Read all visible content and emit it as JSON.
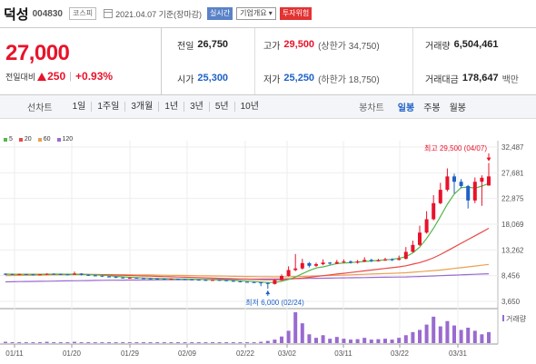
{
  "header": {
    "name": "덕성",
    "code": "004830",
    "market": "코스피",
    "date": "2021.04.07 기준(장마감)",
    "btn_realtime": "실시간",
    "btn_info": "기업개요 ▾",
    "btn_warn": "투자위험"
  },
  "quote": {
    "price": "27,000",
    "change_label": "전일대비",
    "change": "250",
    "change_pct": "+0.93%",
    "prev_label": "전일",
    "prev": "26,750",
    "high_label": "고가",
    "high": "29,500",
    "upper_limit": "(상한가 34,750)",
    "volume_label": "거래량",
    "volume": "6,504,461",
    "open_label": "시가",
    "open": "25,300",
    "low_label": "저가",
    "low": "25,250",
    "lower_limit": "(하한가 18,750)",
    "amount_label": "거래대금",
    "amount": "178,647",
    "amount_unit": "백만"
  },
  "periods": {
    "title": "선차트",
    "items": [
      "1일",
      "1주일",
      "3개월",
      "1년",
      "3년",
      "5년",
      "10년"
    ],
    "chart_type_title": "봉차트",
    "chart_types": [
      "일봉",
      "주봉",
      "월봉"
    ],
    "active_chart_type": "일봉"
  },
  "chart_data": {
    "type": "line",
    "legend": [
      {
        "name": "5",
        "color": "#55b84a"
      },
      {
        "name": "20",
        "color": "#e84848"
      },
      {
        "name": "60",
        "color": "#e9a050"
      },
      {
        "name": "120",
        "color": "#9a6ad0"
      }
    ],
    "y_ticks": [
      "32,487",
      "27,681",
      "22,875",
      "18,069",
      "13,262",
      "8,456",
      "3,650"
    ],
    "x_ticks": [
      "01/11",
      "01/20",
      "01/29",
      "02/09",
      "02/22",
      "03/02",
      "03/11",
      "03/22",
      "03/31"
    ],
    "ylim": [
      3650,
      32487
    ],
    "annotations": {
      "high": "최고 29,500 (04/07)",
      "low": "최저 6,000 (02/24)"
    },
    "volume_label": "거래량",
    "candles": [
      [
        8800,
        8750,
        8900,
        8600
      ],
      [
        8750,
        8700,
        8850,
        8600
      ],
      [
        8700,
        8750,
        8850,
        8600
      ],
      [
        8750,
        8700,
        8800,
        8550
      ],
      [
        8700,
        8650,
        8800,
        8500
      ],
      [
        8650,
        8700,
        8750,
        8550
      ],
      [
        8700,
        8800,
        8900,
        8600
      ],
      [
        8800,
        8750,
        8900,
        8650
      ],
      [
        8750,
        8700,
        8850,
        8600
      ],
      [
        8700,
        8650,
        8800,
        8550
      ],
      [
        8650,
        8850,
        9200,
        8600
      ],
      [
        8850,
        8600,
        8900,
        8500
      ],
      [
        8600,
        8500,
        8700,
        8400
      ],
      [
        8500,
        8450,
        8600,
        8350
      ],
      [
        8450,
        8300,
        8500,
        8200
      ],
      [
        8300,
        8250,
        8400,
        8150
      ],
      [
        8250,
        8100,
        8300,
        8000
      ],
      [
        8100,
        8000,
        8200,
        7950
      ],
      [
        8000,
        8050,
        8150,
        7900
      ],
      [
        8050,
        8000,
        8100,
        7900
      ],
      [
        8000,
        7950,
        8050,
        7850
      ],
      [
        7950,
        7900,
        8000,
        7800
      ],
      [
        7900,
        7850,
        7950,
        7750
      ],
      [
        7850,
        7800,
        7900,
        7700
      ],
      [
        7800,
        7850,
        7950,
        7700
      ],
      [
        7850,
        7800,
        7900,
        7700
      ],
      [
        7800,
        7750,
        7850,
        7650
      ],
      [
        7750,
        7700,
        7800,
        7600
      ],
      [
        7700,
        7650,
        7750,
        7550
      ],
      [
        7650,
        7600,
        7700,
        7500
      ],
      [
        7600,
        7650,
        7700,
        7500
      ],
      [
        7650,
        7600,
        7700,
        7500
      ],
      [
        7600,
        7500,
        7650,
        7400
      ],
      [
        7500,
        7400,
        7550,
        7300
      ],
      [
        7400,
        7300,
        7450,
        7200
      ],
      [
        7300,
        7250,
        7350,
        7150
      ],
      [
        7250,
        7200,
        7300,
        7100
      ],
      [
        7200,
        7100,
        7250,
        6500
      ],
      [
        7100,
        6900,
        7150,
        6000
      ],
      [
        6900,
        7600,
        7800,
        6800
      ],
      [
        7600,
        8400,
        8700,
        7500
      ],
      [
        8400,
        9500,
        10200,
        8300
      ],
      [
        9500,
        9800,
        12500,
        9300
      ],
      [
        9800,
        10800,
        11600,
        9600
      ],
      [
        10800,
        10300,
        11000,
        10000
      ],
      [
        10300,
        10600,
        10900,
        10100
      ],
      [
        10600,
        10900,
        11500,
        10400
      ],
      [
        10900,
        10700,
        11000,
        10500
      ],
      [
        10700,
        11000,
        11400,
        10600
      ],
      [
        11000,
        11100,
        11500,
        10800
      ],
      [
        11100,
        10900,
        11300,
        10700
      ],
      [
        10900,
        11100,
        11400,
        10700
      ],
      [
        11100,
        11400,
        11900,
        11000
      ],
      [
        11400,
        11200,
        11600,
        11000
      ],
      [
        11200,
        11300,
        11600,
        11100
      ],
      [
        11300,
        11500,
        11800,
        11200
      ],
      [
        11500,
        11400,
        11700,
        11200
      ],
      [
        11400,
        11600,
        12200,
        11300
      ],
      [
        11600,
        12900,
        13800,
        11500
      ],
      [
        12900,
        14200,
        15000,
        12800
      ],
      [
        14200,
        16500,
        17800,
        14000
      ],
      [
        16500,
        19000,
        20500,
        16300
      ],
      [
        19000,
        22000,
        23500,
        18800
      ],
      [
        22000,
        24500,
        25800,
        21800
      ],
      [
        24500,
        27000,
        28500,
        24200
      ],
      [
        27000,
        26000,
        27500,
        23800
      ],
      [
        26000,
        25200,
        26500,
        24800
      ],
      [
        25200,
        22500,
        25400,
        21000
      ],
      [
        22500,
        26000,
        26800,
        22000
      ],
      [
        26000,
        26750,
        27200,
        21500
      ],
      [
        25300,
        27000,
        29500,
        25250
      ]
    ],
    "ma5": [
      8750,
      8730,
      8720,
      8720,
      8710,
      8700,
      8720,
      8740,
      8740,
      8720,
      8740,
      8710,
      8650,
      8610,
      8540,
      8440,
      8320,
      8230,
      8140,
      8080,
      8020,
      7980,
      7950,
      7900,
      7870,
      7840,
      7820,
      7790,
      7760,
      7720,
      7690,
      7660,
      7620,
      7570,
      7500,
      7430,
      7350,
      7270,
      7180,
      7200,
      7400,
      7740,
      8200,
      8800,
      9400,
      9900,
      10100,
      10400,
      10700,
      10800,
      10900,
      11000,
      11100,
      11200,
      11300,
      11400,
      11500,
      11700,
      12000,
      12700,
      13800,
      15400,
      17300,
      19500,
      21800,
      23700,
      24900,
      25000,
      24800,
      25200,
      25700
    ],
    "ma20": [
      8700,
      8700,
      8710,
      8710,
      8710,
      8710,
      8720,
      8720,
      8720,
      8720,
      8710,
      8700,
      8680,
      8660,
      8630,
      8600,
      8560,
      8520,
      8480,
      8440,
      8400,
      8360,
      8320,
      8280,
      8240,
      8200,
      8160,
      8120,
      8080,
      8040,
      8000,
      7960,
      7920,
      7880,
      7840,
      7800,
      7760,
      7720,
      7680,
      7680,
      7720,
      7800,
      7900,
      8000,
      8150,
      8300,
      8450,
      8600,
      8750,
      8900,
      9050,
      9200,
      9350,
      9500,
      9650,
      9800,
      9950,
      10100,
      10300,
      10600,
      10900,
      11300,
      11800,
      12400,
      13100,
      13800,
      14500,
      15200,
      15900,
      16600,
      17300
    ],
    "ma60": [
      8450,
      8480,
      8500,
      8520,
      8540,
      8560,
      8580,
      8600,
      8610,
      8620,
      8630,
      8640,
      8650,
      8650,
      8650,
      8650,
      8640,
      8630,
      8620,
      8610,
      8600,
      8580,
      8560,
      8540,
      8520,
      8500,
      8480,
      8460,
      8440,
      8420,
      8400,
      8380,
      8360,
      8340,
      8320,
      8300,
      8280,
      8260,
      8240,
      8230,
      8240,
      8260,
      8290,
      8320,
      8360,
      8400,
      8440,
      8480,
      8520,
      8560,
      8600,
      8650,
      8700,
      8750,
      8800,
      8850,
      8900,
      8950,
      9000,
      9100,
      9200,
      9300,
      9400,
      9500,
      9650,
      9800,
      9950,
      10100,
      10250,
      10400,
      10550
    ],
    "ma120": [
      7300,
      7320,
      7340,
      7360,
      7380,
      7400,
      7420,
      7440,
      7460,
      7480,
      7500,
      7520,
      7540,
      7560,
      7580,
      7600,
      7610,
      7620,
      7630,
      7640,
      7650,
      7660,
      7670,
      7680,
      7690,
      7700,
      7710,
      7720,
      7730,
      7740,
      7750,
      7760,
      7770,
      7780,
      7790,
      7800,
      7810,
      7820,
      7830,
      7840,
      7860,
      7880,
      7900,
      7920,
      7940,
      7960,
      7980,
      8000,
      8020,
      8040,
      8060,
      8080,
      8100,
      8120,
      8140,
      8160,
      8180,
      8200,
      8220,
      8260,
      8300,
      8350,
      8400,
      8450,
      8500,
      8550,
      8600,
      8650,
      8700,
      8750,
      8800
    ],
    "volumes": [
      3,
      2,
      2,
      2,
      2,
      2,
      3,
      2,
      2,
      2,
      3,
      2,
      2,
      2,
      2,
      2,
      2,
      2,
      2,
      2,
      2,
      2,
      2,
      2,
      2,
      2,
      2,
      2,
      2,
      2,
      2,
      2,
      2,
      2,
      2,
      2,
      2,
      3,
      5,
      8,
      15,
      28,
      70,
      45,
      20,
      12,
      18,
      10,
      14,
      10,
      8,
      9,
      12,
      8,
      9,
      10,
      8,
      12,
      18,
      25,
      30,
      42,
      60,
      38,
      50,
      40,
      30,
      35,
      28,
      20,
      25
    ]
  }
}
